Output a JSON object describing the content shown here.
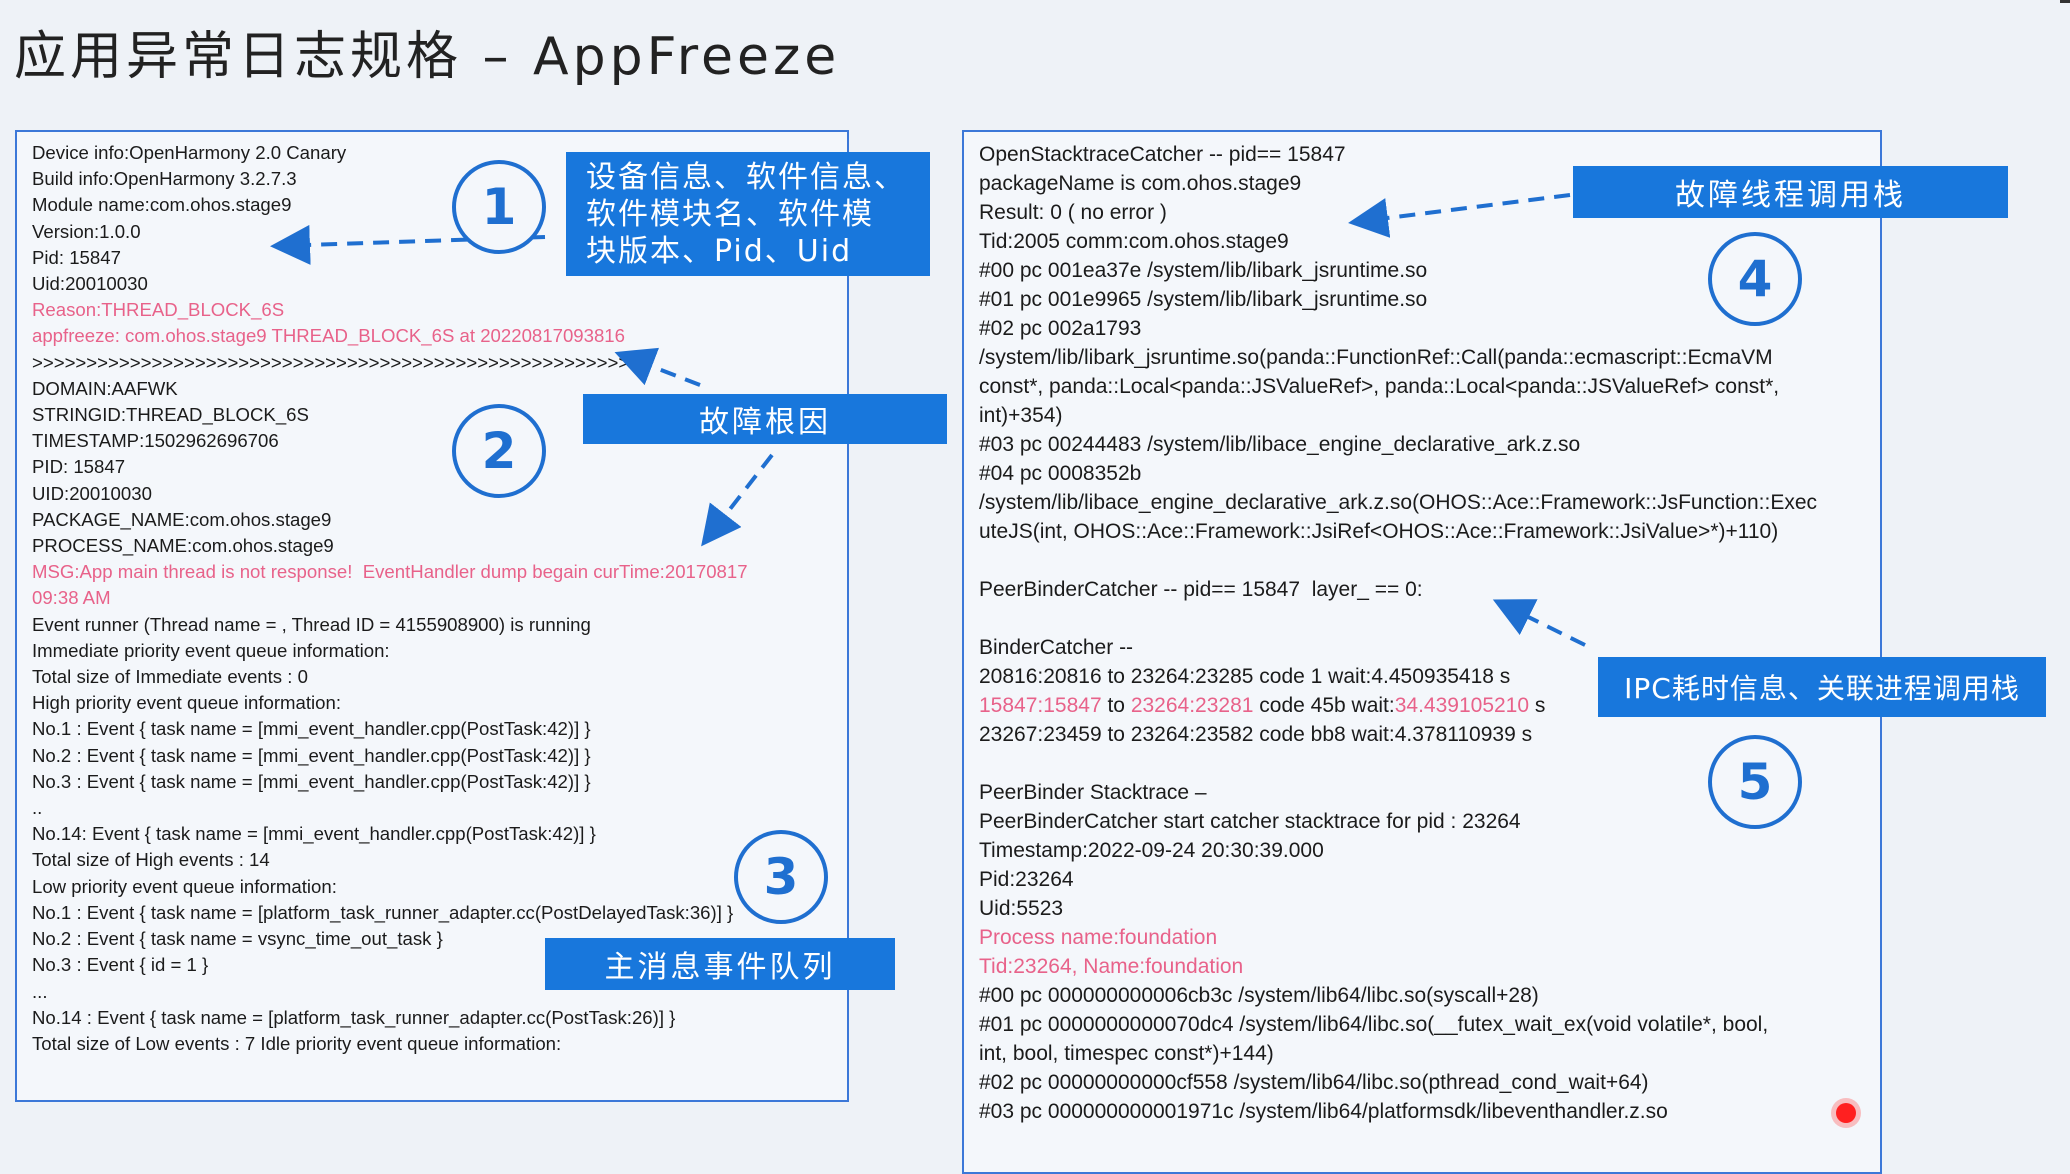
{
  "title": "应用异常日志规格 – AppFreeze",
  "left_log": [
    {
      "text": "Device info:OpenHarmony 2.0 Canary"
    },
    {
      "text": "Build info:OpenHarmony 3.2.7.3"
    },
    {
      "text": "Module name:com.ohos.stage9"
    },
    {
      "text": "Version:1.0.0"
    },
    {
      "text": "Pid: 15847"
    },
    {
      "text": "Uid:20010030"
    },
    {
      "text": "Reason:THREAD_BLOCK_6S",
      "red": true
    },
    {
      "text": "appfreeze: com.ohos.stage9 THREAD_BLOCK_6S at 20220817093816",
      "red": true
    },
    {
      "text": ">>>>>>>>>>>>>>>>>>>>>>>>>>>>>>>>>>>>>>>>>>>>>>>>>>>>>>>>"
    },
    {
      "text": "DOMAIN:AAFWK"
    },
    {
      "text": "STRINGID:THREAD_BLOCK_6S"
    },
    {
      "text": "TIMESTAMP:1502962696706"
    },
    {
      "text": "PID: 15847"
    },
    {
      "text": "UID:20010030"
    },
    {
      "text": "PACKAGE_NAME:com.ohos.stage9"
    },
    {
      "text": "PROCESS_NAME:com.ohos.stage9"
    },
    {
      "text": "MSG:App main thread is not response!  EventHandler dump begain curTime:20170817",
      "red": true
    },
    {
      "text": "09:38 AM",
      "red": true
    },
    {
      "text": "Event runner (Thread name = , Thread ID = 4155908900) is running"
    },
    {
      "text": "Immediate priority event queue information:"
    },
    {
      "text": "Total size of Immediate events : 0"
    },
    {
      "text": "High priority event queue information:"
    },
    {
      "text": "No.1 : Event { task name = [mmi_event_handler.cpp(PostTask:42)] }"
    },
    {
      "text": "No.2 : Event { task name = [mmi_event_handler.cpp(PostTask:42)] }"
    },
    {
      "text": "No.3 : Event { task name = [mmi_event_handler.cpp(PostTask:42)] }"
    },
    {
      "text": ".."
    },
    {
      "text": "No.14: Event { task name = [mmi_event_handler.cpp(PostTask:42)] }"
    },
    {
      "text": "Total size of High events : 14"
    },
    {
      "text": "Low priority event queue information:"
    },
    {
      "text": "No.1 : Event { task name = [platform_task_runner_adapter.cc(PostDelayedTask:36)] }"
    },
    {
      "text": "No.2 : Event { task name = vsync_time_out_task }"
    },
    {
      "text": "No.3 : Event { id = 1 }"
    },
    {
      "text": "..."
    },
    {
      "text": "No.14 : Event { task name = [platform_task_runner_adapter.cc(PostTask:26)] }"
    },
    {
      "text": "Total size of Low events : 7 Idle priority event queue information:"
    }
  ],
  "right_log": [
    {
      "text": "OpenStacktraceCatcher -- pid== 15847"
    },
    {
      "text": "packageName is com.ohos.stage9"
    },
    {
      "text": "Result: 0 ( no error )"
    },
    {
      "text": "Tid:2005 comm:com.ohos.stage9"
    },
    {
      "text": "#00 pc 001ea37e /system/lib/libark_jsruntime.so"
    },
    {
      "text": "#01 pc 001e9965 /system/lib/libark_jsruntime.so"
    },
    {
      "text": "#02 pc 002a1793"
    },
    {
      "text": "/system/lib/libark_jsruntime.so(panda::FunctionRef::Call(panda::ecmascript::EcmaVM"
    },
    {
      "text": "const*, panda::Local<panda::JSValueRef>, panda::Local<panda::JSValueRef> const*,"
    },
    {
      "text": "int)+354)"
    },
    {
      "text": "#03 pc 00244483 /system/lib/libace_engine_declarative_ark.z.so"
    },
    {
      "text": "#04 pc 0008352b"
    },
    {
      "text": "/system/lib/libace_engine_declarative_ark.z.so(OHOS::Ace::Framework::JsFunction::Exec"
    },
    {
      "text": "uteJS(int, OHOS::Ace::Framework::JsiRef<OHOS::Ace::Framework::JsiValue>*)+110)"
    },
    {
      "text": ""
    },
    {
      "text": "PeerBinderCatcher -- pid== 15847  layer_ == 0:"
    },
    {
      "text": ""
    },
    {
      "text": "BinderCatcher --"
    },
    {
      "text": "20816:20816 to 23264:23285 code 1 wait:4.450935418 s"
    },
    {
      "segments": [
        {
          "text": "15847:15847",
          "red": true
        },
        {
          "text": " to "
        },
        {
          "text": "23264:23281",
          "red": true
        },
        {
          "text": " code 45b wait:"
        },
        {
          "text": "34.439105210",
          "red": true
        },
        {
          "text": " s"
        }
      ]
    },
    {
      "text": "23267:23459 to 23264:23582 code bb8 wait:4.378110939 s"
    },
    {
      "text": ""
    },
    {
      "text": "PeerBinder Stacktrace –"
    },
    {
      "text": "PeerBinderCatcher start catcher stacktrace for pid : 23264"
    },
    {
      "text": "Timestamp:2022-09-24 20:30:39.000"
    },
    {
      "text": "Pid:23264"
    },
    {
      "text": "Uid:5523"
    },
    {
      "text": "Process name:foundation",
      "red": true
    },
    {
      "text": "Tid:23264, Name:foundation",
      "red": true
    },
    {
      "text": "#00 pc 000000000006cb3c /system/lib64/libc.so(syscall+28)"
    },
    {
      "text": "#01 pc 0000000000070dc4 /system/lib64/libc.so(__futex_wait_ex(void volatile*, bool,"
    },
    {
      "text": "int, bool, timespec const*)+144)"
    },
    {
      "text": "#02 pc 00000000000cf558 /system/lib64/libc.so(pthread_cond_wait+64)"
    },
    {
      "text": "#03 pc 000000000001971c /system/lib64/platformsdk/libeventhandler.z.so"
    }
  ],
  "callouts": {
    "c1_lines": [
      "设备信息、软件信息、",
      "软件模块名、软件模",
      "块版本、Pid、Uid"
    ],
    "c2": "故障根因",
    "c3": "主消息事件队列",
    "c4": "故障线程调用栈",
    "c5": "IPC耗时信息、关联进程调用栈"
  },
  "numbers": {
    "n1": "1",
    "n2": "2",
    "n3": "3",
    "n4": "4",
    "n5": "5"
  },
  "colors": {
    "accent": "#1877dc",
    "highlight": "#e8628a",
    "border": "#3c78d8"
  }
}
